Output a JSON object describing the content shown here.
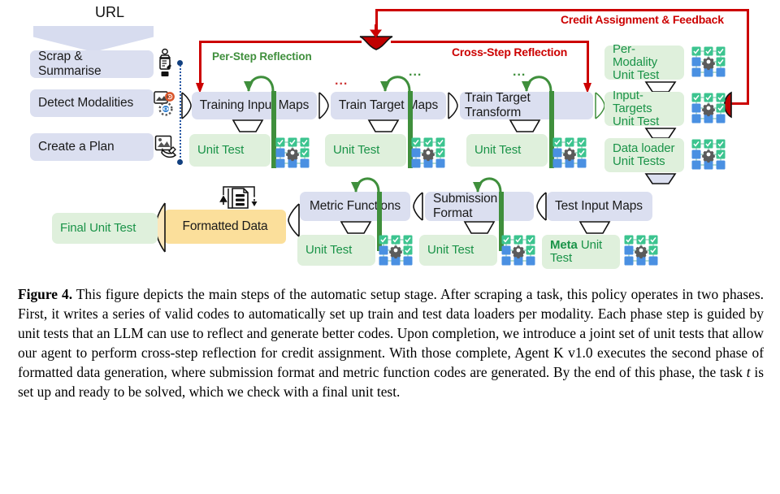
{
  "figure": {
    "url_label": "URL",
    "left_steps": [
      {
        "label": "Scrap & Summarise",
        "icon": "scraper-icon"
      },
      {
        "label": "Detect Modalities",
        "icon": "modality-gears-icon"
      },
      {
        "label": "Create a Plan",
        "icon": "plan-hand-icon"
      }
    ],
    "top_pipeline": [
      {
        "label": "Training Input Maps",
        "unit_test": "Unit Test"
      },
      {
        "label": "Train Target Maps",
        "unit_test": "Unit Test"
      },
      {
        "label": "Train Target Transform",
        "unit_test": "Unit Test"
      }
    ],
    "joint_tests": [
      {
        "label": "Per- Modality\nUnit Test"
      },
      {
        "label": "Input-Targets\nUnit Test"
      },
      {
        "label": "Data loader\nUnit Tests"
      }
    ],
    "bottom_pipeline": [
      {
        "label": "Test Input Maps",
        "unit_test": "Meta Unit Test",
        "unit_test_bold": "Meta"
      },
      {
        "label": "Submission Format",
        "unit_test": "Unit Test"
      },
      {
        "label": "Metric Functions",
        "unit_test": "Unit Test"
      }
    ],
    "formatted_data": "Formatted Data",
    "final_unit_test": "Final Unit Test",
    "annotations": {
      "per_step": "Per-Step Reflection",
      "cross_step": "Cross-Step Reflection",
      "credit": "Credit Assignment & Feedback",
      "ellipsis": "..."
    },
    "colors": {
      "process_box": "#dbdff0",
      "test_box": "#dff0dc",
      "test_text": "#1a9348",
      "data_box": "#fbdf9b",
      "red": "#cc0000",
      "green_arc": "#3f8f3c",
      "blue_dotted": "#2255a4"
    }
  },
  "caption": {
    "label": "Figure 4.",
    "text": " This figure depicts the main steps of the automatic setup stage. After scraping a task, this policy operates in two phases. First, it writes a series of valid codes to automatically set up train and test data loaders per modality. Each phase step is guided by unit tests that an LLM can use to reflect and generate better codes. Upon completion, we introduce a joint set of unit tests that allow our agent to perform cross-step reflection for credit assignment. With those complete, Agent K v1.0 executes the second phase of formatted data generation, where submission format and metric function codes are generated. By the end of this phase, the task ",
    "italic_var": "t",
    "text_tail": " is set up and ready to be solved, which we check with a final unit test."
  }
}
